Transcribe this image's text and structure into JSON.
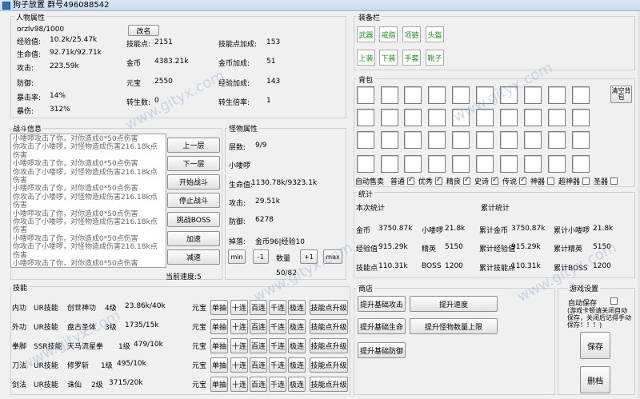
{
  "window": {
    "title": "狗子放置 群号496088542"
  },
  "attributes": {
    "section_title": "人物属性",
    "player_name": "orzlv98/1000",
    "rename_btn": "改名",
    "rows": [
      {
        "label": "经验值:",
        "value": "10.2k/25.47k"
      },
      {
        "label": "生命值:",
        "value": "92.71k/92.71k"
      },
      {
        "label": "攻击:",
        "value": "223.59k"
      },
      {
        "label": "防御:",
        "value": ""
      },
      {
        "label": "暴击率:",
        "value": "14%"
      },
      {
        "label": "暴伤:",
        "value": "312%"
      }
    ],
    "mid": [
      {
        "label": "技能点:",
        "value": "2151"
      },
      {
        "label": "金币",
        "value": "4383.21k"
      },
      {
        "label": "元宝",
        "value": "2550"
      },
      {
        "label": "转生数:",
        "value": "0"
      }
    ],
    "right": [
      {
        "label": "技能点加成:",
        "value": "153"
      },
      {
        "label": "金币加成:",
        "value": "51"
      },
      {
        "label": "经验加成:",
        "value": "143"
      },
      {
        "label": "转生倍率:",
        "value": "1"
      }
    ]
  },
  "equipment": {
    "section_title": "装备栏",
    "row1": [
      "武器",
      "戒指",
      "项链",
      "头盔"
    ],
    "row2": [
      "上装",
      "下装",
      "手套",
      "靴子"
    ]
  },
  "backpack": {
    "section_title": "背包",
    "clear_btn": "清空背包",
    "auto_sell_label": "自动售卖",
    "rarities": [
      {
        "name": "普通",
        "checked": true
      },
      {
        "name": "优秀",
        "checked": true
      },
      {
        "name": "精良",
        "checked": true
      },
      {
        "name": "史诗",
        "checked": true
      },
      {
        "name": "传说",
        "checked": true
      },
      {
        "name": "神器",
        "checked": false
      },
      {
        "name": "超神器",
        "checked": false
      },
      {
        "name": "圣器",
        "checked": false
      }
    ]
  },
  "battle": {
    "section_title": "战斗信息",
    "log": [
      "小喽啰攻击了你，对你造成0*50点伤害",
      "你攻击了小喽啰，对怪物造成伤害216.18k点伤害",
      "小喽啰攻击了你，对你造成0*50点伤害",
      "你攻击了小喽啰，对怪物造成伤害216.18k点伤害",
      "小喽啰攻击了你，对你造成0*50点伤害",
      "你攻击了小喽啰，对怪物造成伤害216.18k点伤害",
      "小喽啰攻击了你，对你造成0*50点伤害",
      "你攻击了小喽啰，对怪物造成伤害216.18k点伤害",
      "小喽啰攻击了你，对你造成0*50点伤害",
      "你攻击了小喽啰，对怪物造成伤害216.18k点伤害",
      "小喽啰攻击了你，对你造成0*50点伤害"
    ],
    "buttons": [
      "上一层",
      "下一层",
      "开始战斗",
      "停止战斗",
      "挑战BOSS",
      "加速",
      "减速"
    ],
    "speed_label": "当前速度:5"
  },
  "monster": {
    "section_title": "怪物属性",
    "floor_label": "层数:",
    "floor_value": "9/9",
    "name": "小喽啰",
    "hp_label": "生命值:",
    "hp_value": "1130.78k/9323.1k",
    "atk_label": "攻击:",
    "atk_value": "29.51k",
    "def_label": "防御:",
    "def_value": "6278",
    "drop_label": "掉落:",
    "drop_value": "金币96|经验10",
    "min_btn": "min",
    "minus_btn": "-1",
    "qty_label": "数量",
    "plus_btn": "+1",
    "max_btn": "max",
    "qty_value": "50/82"
  },
  "stats": {
    "section_title": "统计",
    "current_title": "本次统计",
    "total_title": "累计统计",
    "current": [
      [
        "金币",
        "3750.87k",
        "小喽啰",
        "21.8k"
      ],
      [
        "经验值",
        "915.29k",
        "精英",
        "5150"
      ],
      [
        "技能点",
        "110.31k",
        "BOSS",
        "1200"
      ]
    ],
    "total": [
      [
        "累计金币",
        "3750.87k",
        "累计小喽啰",
        "21.8k"
      ],
      [
        "累计经验值",
        "915.29k",
        "累计精英",
        "5150"
      ],
      [
        "累计技能点",
        "110.31k",
        "累计BOSS",
        "1200"
      ]
    ]
  },
  "skills": {
    "section_title": "技能",
    "currency": "元宝",
    "btn_draw": [
      "单抽",
      "十连",
      "百连",
      "千连",
      "极连"
    ],
    "upgrade_btn": "技能点升级",
    "rows": [
      {
        "slot": "内功",
        "grade": "UR技能",
        "name": "创世神功",
        "level": "4级",
        "exp": "23.86k/40k"
      },
      {
        "slot": "外功",
        "grade": "UR技能",
        "name": "盘古圣体",
        "level": "3级",
        "exp": "1735/15k"
      },
      {
        "slot": "拳脚",
        "grade": "SSR技能",
        "name": "天马流星拳",
        "level": "1级",
        "exp": "479/10k"
      },
      {
        "slot": "刀法",
        "grade": "UR技能",
        "name": "修罗斩",
        "level": "1级",
        "exp": "495/10k"
      },
      {
        "slot": "剑法",
        "grade": "UR技能",
        "name": "诛仙",
        "level": "2级",
        "exp": "3715/20k"
      }
    ]
  },
  "shop": {
    "section_title": "商店",
    "buttons": [
      "提升基础攻击",
      "提升速度",
      "提升基础生命",
      "提升怪物数量上限",
      "提升基础防御"
    ]
  },
  "settings": {
    "section_title": "游戏设置",
    "autosave_label": "自动保存",
    "autosave_note": "(游戏卡顿请关闭自动保存，关闭后记得手动保存！！！)",
    "save_btn": "保存",
    "delete_btn": "删档"
  },
  "watermark": "www.gityx.com"
}
